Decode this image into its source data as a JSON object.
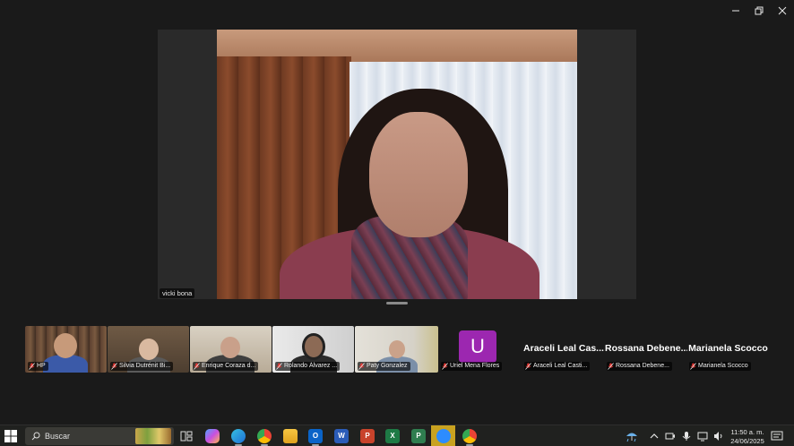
{
  "window": {
    "controls": [
      {
        "name": "minimize",
        "glyph": "minimize-icon"
      },
      {
        "name": "restore",
        "glyph": "restore-icon"
      },
      {
        "name": "close",
        "glyph": "close-icon"
      }
    ]
  },
  "main_video": {
    "speaker_name": "vicki bona"
  },
  "gallery": {
    "video_tiles": [
      {
        "name": "HP",
        "muted": true
      },
      {
        "name": "Silvia Dutrénit Bi...",
        "muted": true
      },
      {
        "name": "Enrique Coraza d...",
        "muted": true
      },
      {
        "name": "Rolando Álvarez ...",
        "muted": true
      },
      {
        "name": "Paty Gonzalez",
        "muted": true
      }
    ],
    "name_tiles": [
      {
        "display": "U",
        "name": "Uriel Mena Flores",
        "avatar_color": "#9c27b0",
        "muted": true
      },
      {
        "display": "Araceli Leal Cas...",
        "name": "Araceli Leal Casti...",
        "muted": true
      },
      {
        "display": "Rossana Debene...",
        "name": "Rossana Debene...",
        "muted": true
      },
      {
        "display": "Marianela Scocco",
        "name": "Marianela Scocco",
        "muted": true
      }
    ]
  },
  "taskbar": {
    "search_placeholder": "Buscar",
    "apps": [
      {
        "name": "task-view"
      },
      {
        "name": "copilot"
      },
      {
        "name": "edge"
      },
      {
        "name": "chrome"
      },
      {
        "name": "file-explorer"
      },
      {
        "name": "outlook",
        "letter": "O"
      },
      {
        "name": "word",
        "letter": "W"
      },
      {
        "name": "powerpoint",
        "letter": "P"
      },
      {
        "name": "excel",
        "letter": "X"
      },
      {
        "name": "project",
        "letter": "P"
      },
      {
        "name": "zoom",
        "active": true
      },
      {
        "name": "chrome-profile"
      }
    ],
    "time": "11:50 a. m.",
    "date": "24/06/2025"
  }
}
